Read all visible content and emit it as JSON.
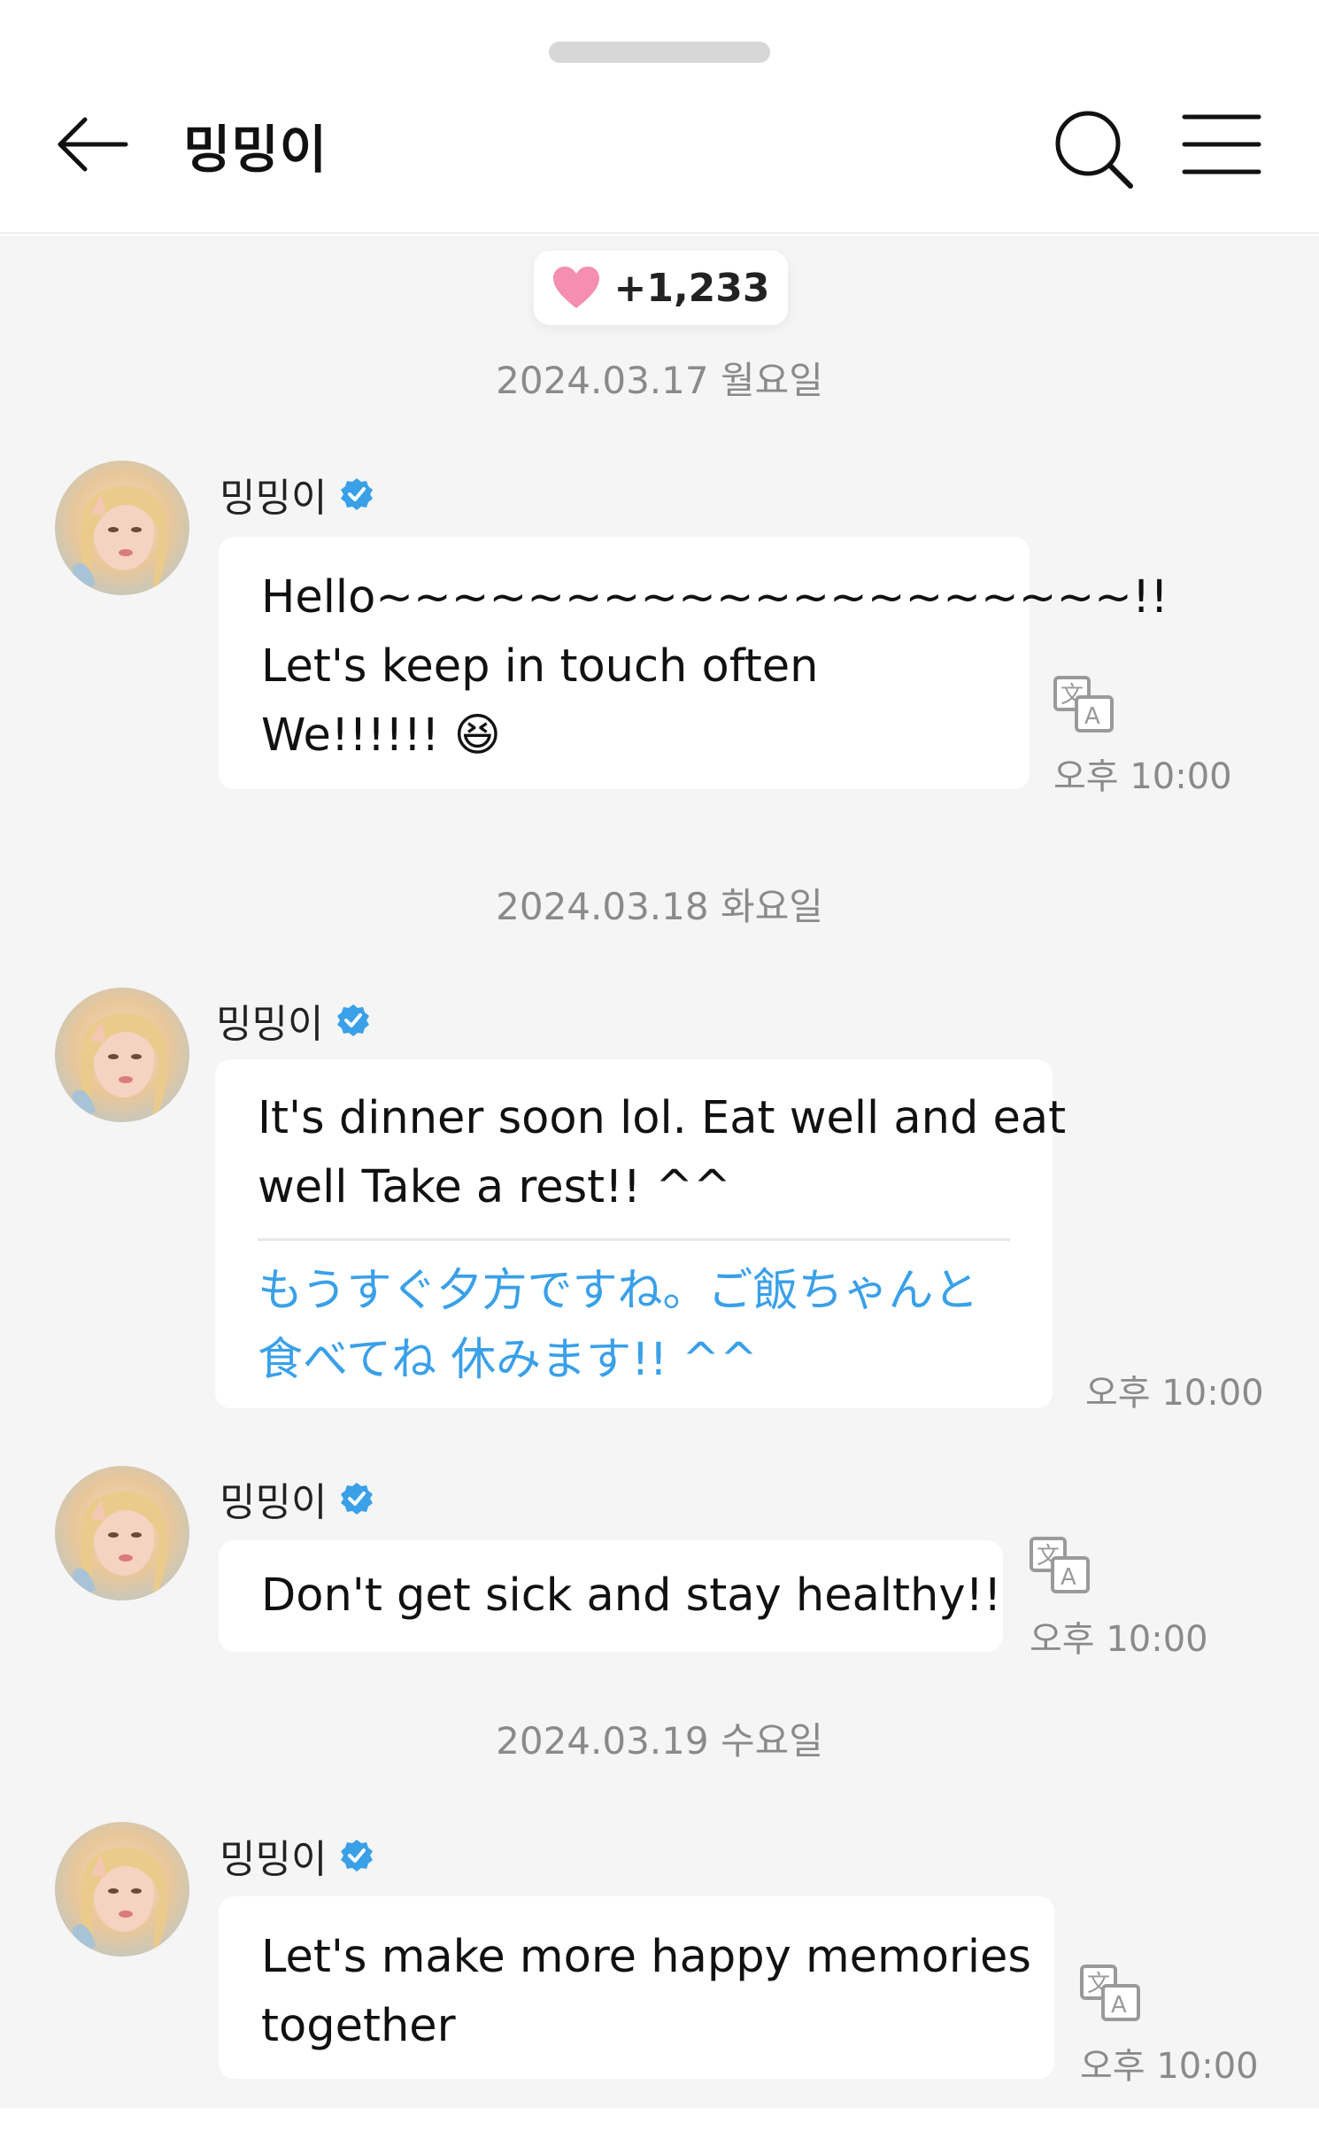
{
  "header": {
    "title": "밍밍이",
    "back_label": "",
    "search_label": "",
    "menu_label": ""
  },
  "likes": {
    "count": "+1,233",
    "icon": "heart-icon",
    "color": "#f48fb1"
  },
  "colors": {
    "accent_translation": "#3aa0e8",
    "verified": "#3aa0e8",
    "background": "#f5f5f5"
  },
  "dates": [
    "2024.03.17 월요일",
    "2024.03.18 화요일",
    "2024.03.19 수요일"
  ],
  "messages": [
    {
      "sender": "밍밍이",
      "lines": [
        "Hello~~~~~~~~~~~~~~~~~~~~!!",
        "Let's keep in touch often",
        "We!!!!!! 😆"
      ],
      "time": "오후 10:00",
      "show_translate_icon": true
    },
    {
      "sender": "밍밍이",
      "lines": [
        "It's dinner soon lol. Eat well and eat",
        "well Take a rest!! ^^"
      ],
      "translation": [
        "もうすぐ夕方ですね。ご飯ちゃんと",
        "食べてね 休みます!! ^^"
      ],
      "time": "오후 10:00",
      "show_translate_icon": false
    },
    {
      "sender": "밍밍이",
      "lines": [
        "Don't get sick and stay healthy!!"
      ],
      "time": "오후 10:00",
      "show_translate_icon": true
    },
    {
      "sender": "밍밍이",
      "lines": [
        "Let's make more happy memories",
        "together"
      ],
      "time": "오후 10:00",
      "show_translate_icon": true
    }
  ]
}
